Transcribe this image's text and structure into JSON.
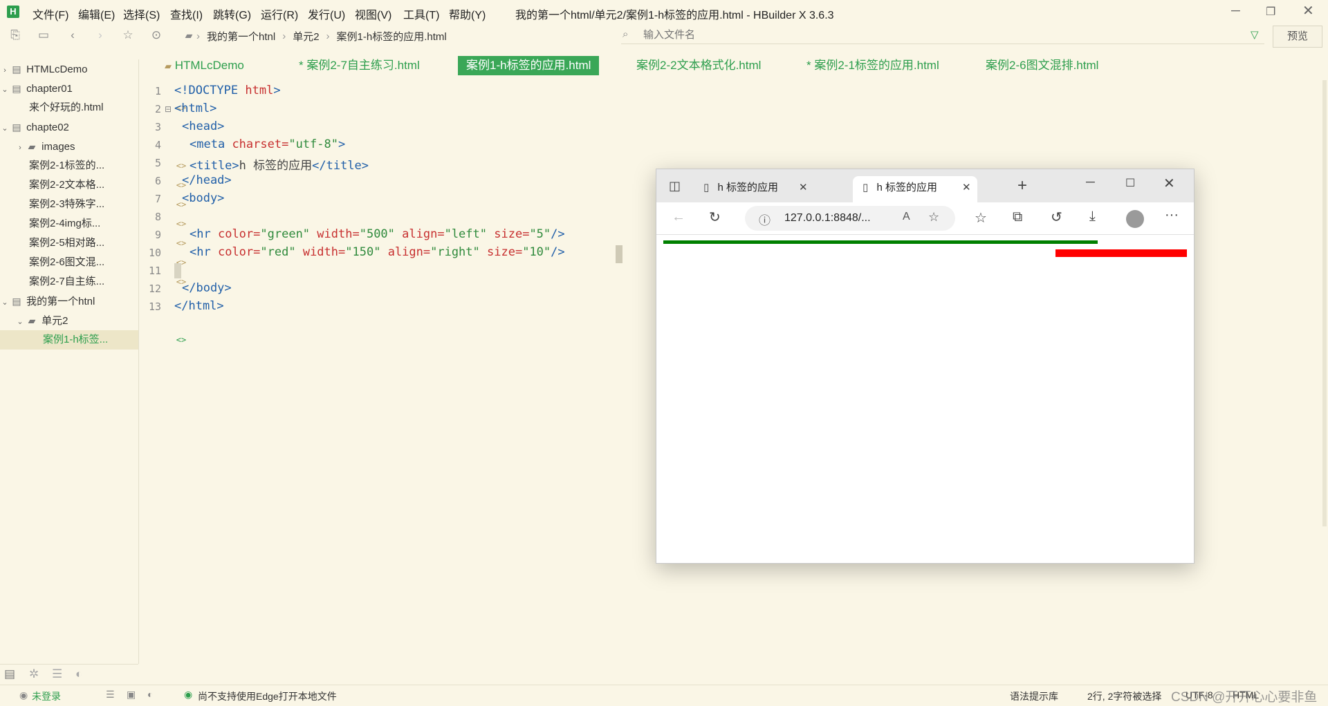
{
  "app": {
    "logo_letter": "H",
    "window_title": "我的第一个html/单元2/案例1-h标签的应用.html - HBuilder X 3.6.3",
    "menus": [
      "文件(F)",
      "编辑(E)",
      "选择(S)",
      "查找(I)",
      "跳转(G)",
      "运行(R)",
      "发行(U)",
      "视图(V)",
      "工具(T)",
      "帮助(Y)"
    ]
  },
  "toolbar": {
    "breadcrumb": [
      "我的第一个htnl",
      "单元2",
      "案例1-h标签的应用.html"
    ],
    "filter_placeholder": "输入文件名",
    "preview_label": "预览"
  },
  "sidebar": {
    "items": [
      {
        "label": "HTMLcDemo",
        "expanded": false
      },
      {
        "label": "chapter01",
        "expanded": true
      },
      {
        "label": "来个好玩的.html"
      },
      {
        "label": "chapte02",
        "expanded": true
      },
      {
        "label": "images",
        "expanded": false
      },
      {
        "label": "案例2-1标签的..."
      },
      {
        "label": "案例2-2文本格..."
      },
      {
        "label": "案例2-3特殊字..."
      },
      {
        "label": "案例2-4img标..."
      },
      {
        "label": "案例2-5相对路..."
      },
      {
        "label": "案例2-6图文混..."
      },
      {
        "label": "案例2-7自主练..."
      },
      {
        "label": "我的第一个htnl",
        "expanded": true
      },
      {
        "label": "单元2",
        "expanded": true
      },
      {
        "label": "案例1-h标签...",
        "selected": true
      }
    ]
  },
  "tabs": [
    {
      "label": "HTMLcDemo"
    },
    {
      "label": "* 案例2-7自主练习.html"
    },
    {
      "label": "案例1-h标签的应用.html",
      "active": true
    },
    {
      "label": "案例2-2文本格式化.html"
    },
    {
      "label": "* 案例2-1标签的应用.html"
    },
    {
      "label": "案例2-6图文混排.html"
    }
  ],
  "editor": {
    "line_numbers": [
      "1",
      "2",
      "3",
      "4",
      "5",
      "6",
      "7",
      "8",
      "9",
      "10",
      "11",
      "12",
      "13"
    ],
    "lines": {
      "l1_tag": "<!DOCTYPE",
      "l1_attr": "html",
      "l1_close": ">",
      "l2": "<html>",
      "l3": "<head>",
      "l4_tag": "<meta",
      "l4_attr": "charset=",
      "l4_val": "\"utf-8\"",
      "l4_close": ">",
      "l5_open": "<title>",
      "l5_text": "h 标签的应用",
      "l5_close": "</title>",
      "l6": "</head>",
      "l7": "<body>",
      "l9_tag": "<hr",
      "l9_a1": "color=",
      "l9_v1": "\"green\"",
      "l9_a2": "width=",
      "l9_v2": "\"500\"",
      "l9_a3": "align=",
      "l9_v3": "\"left\"",
      "l9_a4": "size=",
      "l9_v4": "\"5\"",
      "l9_close": "/>",
      "l10_tag": "<hr",
      "l10_a1": "color=",
      "l10_v1": "\"red\"",
      "l10_a2": "width=",
      "l10_v2": "\"150\"",
      "l10_a3": "align=",
      "l10_v3": "\"right\"",
      "l10_a4": "size=",
      "l10_v4": "\"10\"",
      "l10_close": "/>",
      "l12": "</body>",
      "l13": "</html>"
    }
  },
  "browser": {
    "tabs": [
      "h 标签的应用",
      "h 标签的应用"
    ],
    "url": "127.0.0.1:8848/...",
    "hr_green_color": "#008000",
    "hr_red_color": "#ff0000"
  },
  "status": {
    "login": "未登录",
    "message": "尚不支持使用Edge打开本地文件",
    "hint_lib": "语法提示库",
    "position": "2行, 2字符被选择",
    "encoding": "UTF-8",
    "language": "HTML",
    "watermark": "CSDN @开开心心要非鱼"
  }
}
